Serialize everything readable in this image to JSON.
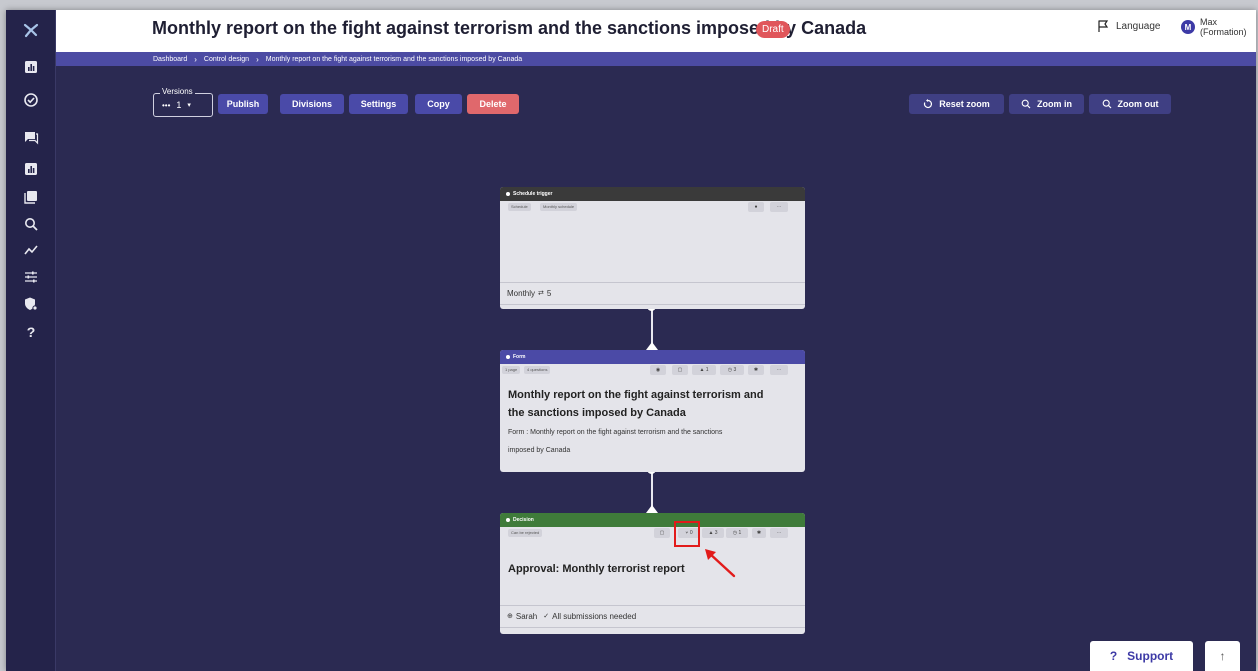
{
  "header": {
    "title": "Monthly report on the fight against terrorism and the sanctions imposed by Canada",
    "badge": "Draft",
    "language_label": "Language",
    "user_initial": "M",
    "user_name": "Max (Formation)"
  },
  "breadcrumb": [
    "Dashboard",
    "Control design",
    "Monthly report on the fight against terrorism and the sanctions imposed by Canada"
  ],
  "toolbar": {
    "versions_label": "Versions",
    "version_value": "1",
    "publish": "Publish",
    "divisions": "Divisions",
    "settings": "Settings",
    "copy": "Copy",
    "delete": "Delete",
    "reset_zoom": "Reset zoom",
    "zoom_in": "Zoom in",
    "zoom_out": "Zoom out"
  },
  "nodes": {
    "schedule": {
      "header": "Schedule trigger",
      "header_color": "#3a3a3a",
      "tags": [
        "Schedule",
        "Monthly schedule"
      ],
      "footer": "Monthly",
      "footer_count": "5"
    },
    "form": {
      "header": "Form",
      "header_color": "#4b4aa6",
      "tags": [
        "1 page",
        "4 questions"
      ],
      "counts": [
        "1",
        "3"
      ],
      "title_line1": "Monthly report on the fight against terrorism and",
      "title_line2": "the sanctions imposed by Canada",
      "desc_line1": "Form : Monthly report on the fight against terrorism and the sanctions",
      "desc_line2": "imposed by Canada"
    },
    "decision": {
      "header": "Decision",
      "header_color": "#3f7b3a",
      "tags": [
        "Can be rejected"
      ],
      "counts": [
        "0",
        "3",
        "1"
      ],
      "title": "Approval: Monthly terrorist report",
      "footer_user": "Sarah",
      "footer_text": "All submissions needed"
    }
  },
  "support": {
    "label": "Support"
  },
  "colors": {
    "accent": "#4a4aa8",
    "danger": "#e0686c",
    "background": "#2b2a52",
    "highlight": "#e21b1b"
  }
}
